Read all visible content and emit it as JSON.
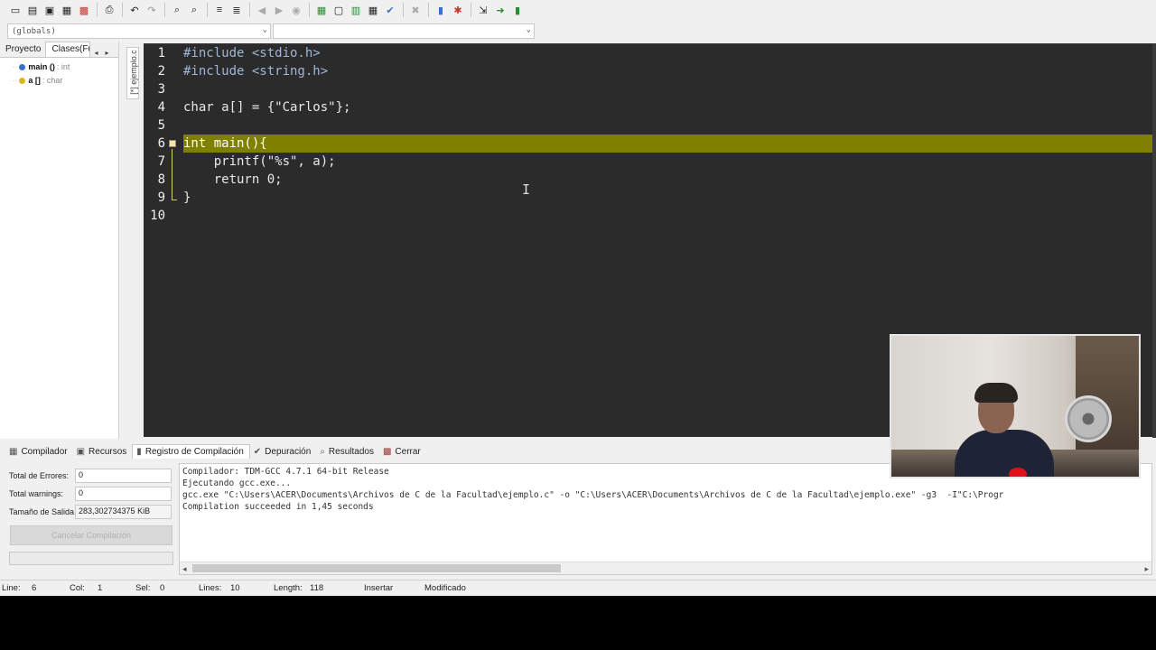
{
  "toolbar": {
    "icons": [
      "new-file-icon",
      "open-file-icon",
      "save-icon",
      "save-all-icon",
      "close-file-icon",
      "print-icon",
      "undo-icon",
      "redo-icon",
      "find-icon",
      "replace-icon",
      "indent-icon",
      "unindent-icon",
      "back-icon",
      "forward-icon",
      "goto-icon",
      "new-project-icon",
      "window-icon",
      "layout-icon",
      "grid-icon",
      "check-syntax-icon",
      "stop-icon",
      "chart-icon",
      "profile-icon",
      "export-icon",
      "run-icon",
      "debug-icon"
    ]
  },
  "scope": {
    "left_value": "(globals)",
    "right_value": ""
  },
  "left_panel": {
    "tabs": [
      "Proyecto",
      "Clases(Fun"
    ],
    "tree": [
      {
        "name": "main ()",
        "type": ": int",
        "color": "#3a6fd8"
      },
      {
        "name": "a []",
        "type": ": char",
        "color": "#d8b820"
      }
    ]
  },
  "editor": {
    "file_tab": "[*] ejemplo.c",
    "lines": [
      {
        "n": "1",
        "text": "#include <stdio.h>"
      },
      {
        "n": "2",
        "text": "#include <string.h>"
      },
      {
        "n": "3",
        "text": ""
      },
      {
        "n": "4",
        "text": "char a[] = {\"Carlos\"};"
      },
      {
        "n": "5",
        "text": ""
      },
      {
        "n": "6",
        "text": "int main(){"
      },
      {
        "n": "7",
        "text": "    printf(\"%s\", a);"
      },
      {
        "n": "8",
        "text": "    return 0;"
      },
      {
        "n": "9",
        "text": "}"
      },
      {
        "n": "10",
        "text": ""
      }
    ],
    "highlight_color": "#808000",
    "cursor_icon": "I"
  },
  "bottom_tabs": [
    {
      "label": "Compilador",
      "icon": "compiler-icon",
      "active": false
    },
    {
      "label": "Recursos",
      "icon": "resources-icon",
      "active": false
    },
    {
      "label": "Registro de Compilación",
      "icon": "build-log-icon",
      "active": true
    },
    {
      "label": "Depuración",
      "icon": "debug-check-icon",
      "active": false
    },
    {
      "label": "Resultados",
      "icon": "results-icon",
      "active": false
    },
    {
      "label": "Cerrar",
      "icon": "close-pane-icon",
      "active": false
    }
  ],
  "compile_stats": {
    "errors_label": "Total de Errores:",
    "errors_value": "0",
    "warnings_label": "Total warnings:",
    "warnings_value": "0",
    "size_label": "Tamaño de Salida",
    "size_value": "283,302734375 KiB",
    "cancel_label": "Cancelar Compilación"
  },
  "log": [
    "Compilador: TDM-GCC 4.7.1 64-bit Release",
    "Ejecutando gcc.exe...",
    "gcc.exe \"C:\\Users\\ACER\\Documents\\Archivos de C de la Facultad\\ejemplo.c\" -o \"C:\\Users\\ACER\\Documents\\Archivos de C de la Facultad\\ejemplo.exe\" -g3  -I\"C:\\Progr",
    "Compilation succeeded in 1,45 seconds"
  ],
  "statusbar": {
    "line_label": "Line:",
    "line_value": "6",
    "col_label": "Col:",
    "col_value": "1",
    "sel_label": "Sel:",
    "sel_value": "0",
    "lines_label": "Lines:",
    "lines_value": "10",
    "length_label": "Length:",
    "length_value": "118",
    "mode": "Insertar",
    "state": "Modificado"
  }
}
